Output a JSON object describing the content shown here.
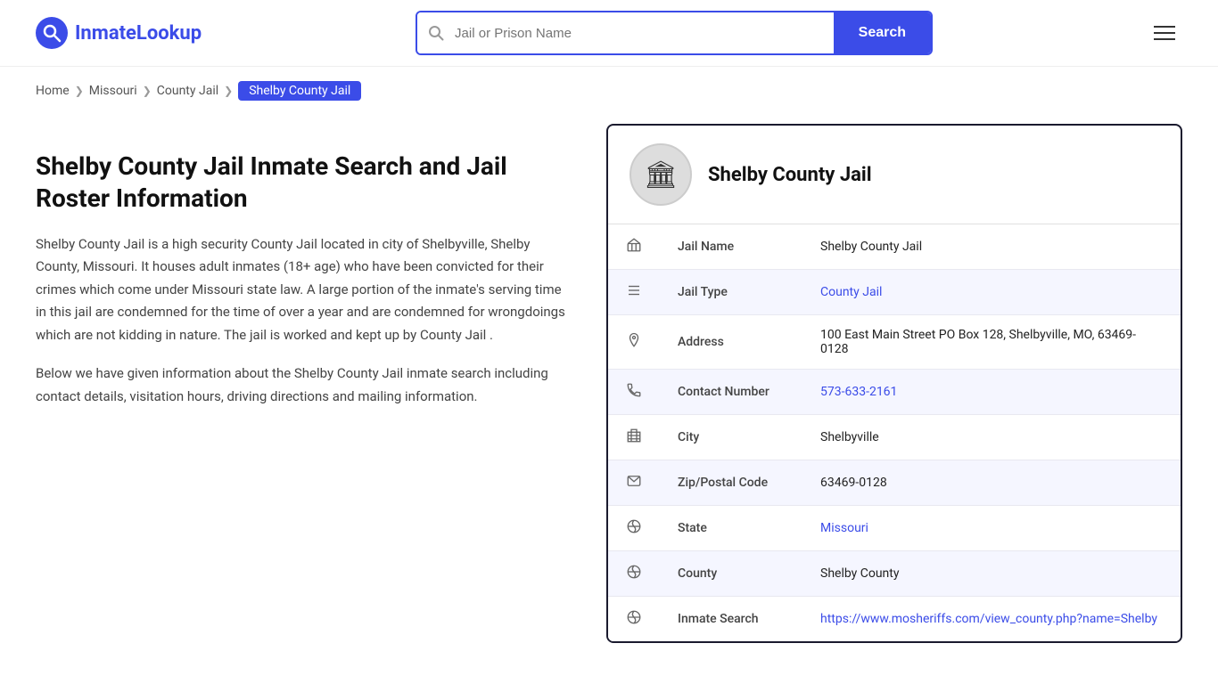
{
  "logo": {
    "icon_symbol": "Q",
    "text": "InmateLookup"
  },
  "header": {
    "search_placeholder": "Jail or Prison Name",
    "search_button_label": "Search"
  },
  "breadcrumb": {
    "items": [
      {
        "label": "Home",
        "href": "#"
      },
      {
        "label": "Missouri",
        "href": "#"
      },
      {
        "label": "County Jail",
        "href": "#"
      },
      {
        "label": "Shelby County Jail",
        "current": true
      }
    ]
  },
  "left": {
    "title": "Shelby County Jail Inmate Search and Jail Roster Information",
    "desc1": "Shelby County Jail is a high security County Jail located in city of Shelbyville, Shelby County, Missouri. It houses adult inmates (18+ age) who have been convicted for their crimes which come under Missouri state law. A large portion of the inmate's serving time in this jail are condemned for the time of over a year and are condemned for wrongdoings which are not kidding in nature. The jail is worked and kept up by County Jail .",
    "desc2": "Below we have given information about the Shelby County Jail inmate search including contact details, visitation hours, driving directions and mailing information."
  },
  "jail_card": {
    "title": "Shelby County Jail",
    "avatar_symbol": "🏛",
    "fields": [
      {
        "icon": "jail-icon",
        "label": "Jail Name",
        "value": "Shelby County Jail",
        "link": null
      },
      {
        "icon": "list-icon",
        "label": "Jail Type",
        "value": "County Jail",
        "link": "#"
      },
      {
        "icon": "pin-icon",
        "label": "Address",
        "value": "100 East Main Street PO Box 128, Shelbyville, MO, 63469-0128",
        "link": null
      },
      {
        "icon": "phone-icon",
        "label": "Contact Number",
        "value": "573-633-2161",
        "link": "tel:573-633-2161"
      },
      {
        "icon": "city-icon",
        "label": "City",
        "value": "Shelbyville",
        "link": null
      },
      {
        "icon": "zip-icon",
        "label": "Zip/Postal Code",
        "value": "63469-0128",
        "link": null
      },
      {
        "icon": "globe-icon",
        "label": "State",
        "value": "Missouri",
        "link": "#"
      },
      {
        "icon": "county-icon",
        "label": "County",
        "value": "Shelby County",
        "link": null
      },
      {
        "icon": "search-globe-icon",
        "label": "Inmate Search",
        "value": "https://www.mosheriffs.com/view_county.php?name=Shelby",
        "link": "https://www.mosheriffs.com/view_county.php?name=Shelby"
      }
    ]
  }
}
